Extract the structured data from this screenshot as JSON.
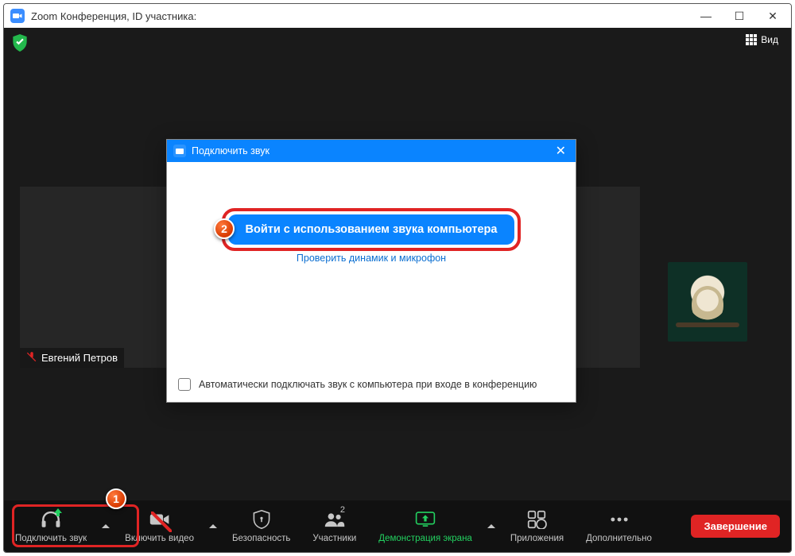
{
  "window": {
    "title": "Zoom Конференция, ID участника:"
  },
  "stage": {
    "view_button": "Вид",
    "participant_name": "Евгений Петров"
  },
  "modal": {
    "title": "Подключить звук",
    "primary_button": "Войти с использованием звука компьютера",
    "test_link": "Проверить динамик и микрофон",
    "auto_checkbox": "Автоматически подключать звук с компьютера при входе в конференцию"
  },
  "toolbar": {
    "audio": "Подключить звук",
    "video": "Включить видео",
    "security": "Безопасность",
    "participants": "Участники",
    "participants_count": "2",
    "share": "Демонстрация экрана",
    "apps": "Приложения",
    "more": "Дополнительно",
    "end": "Завершение"
  },
  "badges": {
    "one": "1",
    "two": "2"
  }
}
